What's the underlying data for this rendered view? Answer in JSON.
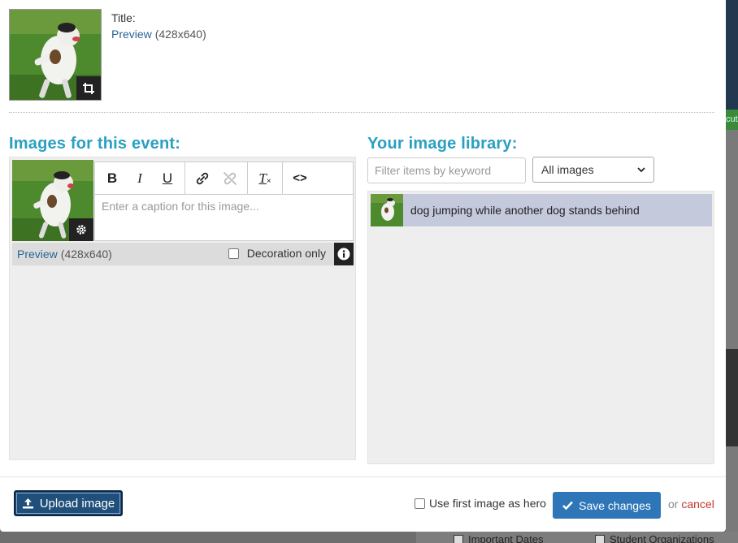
{
  "top": {
    "title_label": "Title:",
    "preview_link": "Preview",
    "dimensions": "(428x640)"
  },
  "event_images": {
    "heading": "Images for this event:",
    "caption_placeholder": "Enter a caption for this image...",
    "preview_link": "Preview",
    "dimensions": "(428x640)",
    "decoration_label": "Decoration only",
    "toolbar": {
      "bold": "B",
      "italic": "I",
      "underline": "U",
      "clear_format": "T",
      "source": "<>"
    }
  },
  "library": {
    "heading": "Your image library:",
    "filter_placeholder": "Filter items by keyword",
    "select_value": "All images",
    "items": [
      {
        "label": "dog jumping while another dog stands behind"
      }
    ]
  },
  "footer": {
    "upload_label": "Upload image",
    "hero_label": "Use first image as hero",
    "save_label": "Save changes",
    "or_text": "or",
    "cancel_label": "cancel"
  },
  "background": {
    "green_text": "cut",
    "bottom_labels": [
      "Important Dates",
      "Student Organizations"
    ]
  },
  "colors": {
    "heading": "#2a9fc1",
    "link": "#2a6496",
    "save_button": "#2e76b8",
    "upload_button": "#1f4f7a",
    "cancel": "#c0392b",
    "library_selected": "#c4c9dc"
  }
}
